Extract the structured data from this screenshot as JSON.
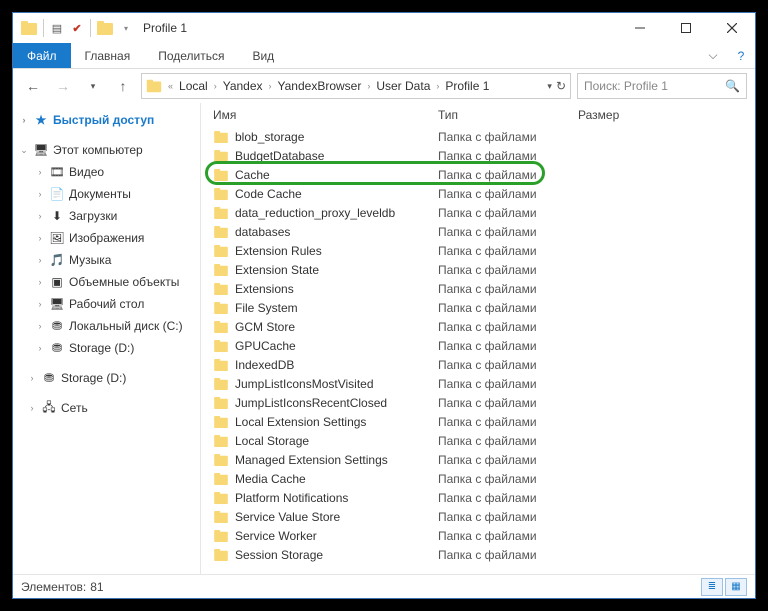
{
  "title": "Profile 1",
  "ribbon": {
    "file": "Файл",
    "tabs": [
      "Главная",
      "Поделиться",
      "Вид"
    ]
  },
  "breadcrumbs": [
    "Local",
    "Yandex",
    "YandexBrowser",
    "User Data",
    "Profile 1"
  ],
  "search_placeholder": "Поиск: Profile 1",
  "columns": {
    "name": "Имя",
    "type": "Тип",
    "size": "Размер"
  },
  "nav": {
    "quick_access": "Быстрый доступ",
    "this_pc": "Этот компьютер",
    "items": [
      {
        "label": "Видео",
        "icon": "🎞"
      },
      {
        "label": "Документы",
        "icon": "📄"
      },
      {
        "label": "Загрузки",
        "icon": "⬇"
      },
      {
        "label": "Изображения",
        "icon": "🖼"
      },
      {
        "label": "Музыка",
        "icon": "🎵"
      },
      {
        "label": "Объемные объекты",
        "icon": "▣"
      },
      {
        "label": "Рабочий стол",
        "icon": "🖥"
      },
      {
        "label": "Локальный диск (C:)",
        "icon": "⛃"
      },
      {
        "label": "Storage (D:)",
        "icon": "⛃"
      }
    ],
    "storage_d": "Storage (D:)",
    "network": "Сеть"
  },
  "folder_type_label": "Папка с файлами",
  "files": [
    "blob_storage",
    "BudgetDatabase",
    "Cache",
    "Code Cache",
    "data_reduction_proxy_leveldb",
    "databases",
    "Extension Rules",
    "Extension State",
    "Extensions",
    "File System",
    "GCM Store",
    "GPUCache",
    "IndexedDB",
    "JumpListIconsMostVisited",
    "JumpListIconsRecentClosed",
    "Local Extension Settings",
    "Local Storage",
    "Managed Extension Settings",
    "Media Cache",
    "Platform Notifications",
    "Service Value Store",
    "Service Worker",
    "Session Storage"
  ],
  "highlight_index": 2,
  "status": {
    "label": "Элементов:",
    "count": "81"
  }
}
